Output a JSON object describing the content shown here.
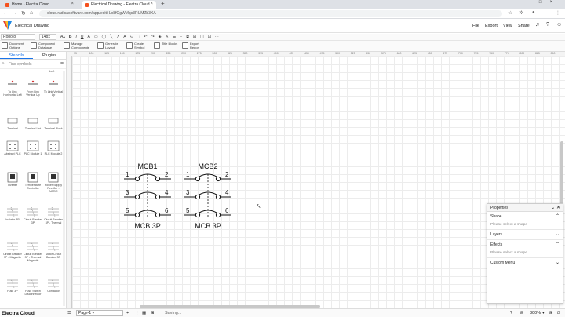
{
  "browser": {
    "tabs": [
      {
        "label": "Home - Electra Cloud",
        "active": false,
        "color": "#f4511e"
      },
      {
        "label": "Electrical Drawing - Electra Cloud",
        "active": true,
        "color": "#f4511e"
      }
    ],
    "url": "cloud.radicasoftware.com/app/edit/-Lx8fGgWMqs3RUMZb3XA"
  },
  "app": {
    "title": "Electrical Drawing",
    "menu": [
      "File",
      "Export",
      "View",
      "Share"
    ]
  },
  "toolbar_top": {
    "font": "Roboto",
    "size": "14px"
  },
  "toolbar_tools": [
    {
      "label": "Document Options",
      "icon": "document-icon"
    },
    {
      "label": "Component Database",
      "icon": "database-icon"
    },
    {
      "label": "Manage Components",
      "icon": "manage-icon"
    },
    {
      "label": "Generate Layout",
      "icon": "layout-icon"
    },
    {
      "label": "Create Symbol",
      "icon": "symbol-icon"
    },
    {
      "label": "Title Blocks",
      "icon": "title-block-icon"
    },
    {
      "label": "Export Report",
      "icon": "report-icon"
    }
  ],
  "sidebar": {
    "tabs": [
      "Stencils",
      "Plugins"
    ],
    "search_placeholder": "Find symbols",
    "top_label": "Left",
    "symbols": [
      "To Link Horizontal Left",
      "From Link Vertical Up",
      "To Link Vertical Up",
      "Terminal",
      "Terminal List",
      "Terminal Block",
      "Abstract PLC",
      "PLC Module 1",
      "PLC Module 2",
      "Inverter",
      "Temperature Controller",
      "Power Supply Rectifier - AC/DC",
      "Isolator 3P",
      "Circuit Breaker 3P",
      "Circuit Breaker 3P - Thermal",
      "Circuit Breaker 3P - Magnetic",
      "Circuit Breaker 3P - Thermal Magnetic",
      "Motor Circuit Breaker 3P",
      "Fuse 3P",
      "Fuse Switch Disconnector",
      "Contactor"
    ],
    "sym_labels_small": {
      "terminal": "#10",
      "terminal_list": "101",
      "tb_top": "101",
      "tb_bottom": "102",
      "temp": "12.0"
    }
  },
  "ruler_ticks": [
    "75",
    "100",
    "125",
    "150",
    "175",
    "200",
    "225",
    "250",
    "275",
    "300",
    "325",
    "350",
    "375",
    "400",
    "425",
    "450",
    "475",
    "500",
    "525",
    "550",
    "575",
    "600",
    "625",
    "650",
    "675",
    "700",
    "725",
    "750",
    "775",
    "800",
    "825",
    "850"
  ],
  "diagram": {
    "breakers": [
      {
        "name": "MCB1",
        "caption": "MCB 3P",
        "pins": [
          "1",
          "2",
          "3",
          "4",
          "5",
          "6"
        ]
      },
      {
        "name": "MCB2",
        "caption": "MCB 3P",
        "pins": [
          "1",
          "2",
          "3",
          "4",
          "5",
          "6"
        ]
      }
    ]
  },
  "properties": {
    "title": "Properties",
    "sections": [
      {
        "name": "Shape",
        "hint": "Please select a shape"
      },
      {
        "name": "Layers",
        "hint": ""
      },
      {
        "name": "Effects",
        "hint": "Please select a shape"
      },
      {
        "name": "Custom Menu",
        "hint": ""
      }
    ]
  },
  "status": {
    "brand": "Electra Cloud",
    "page": "Page-1",
    "saving": "Saving...",
    "zoom": "300%"
  },
  "colors": {
    "accent": "#1a73e8",
    "logo1": "#e53935",
    "logo2": "#1e88e5",
    "logo3": "#fbc02d"
  }
}
